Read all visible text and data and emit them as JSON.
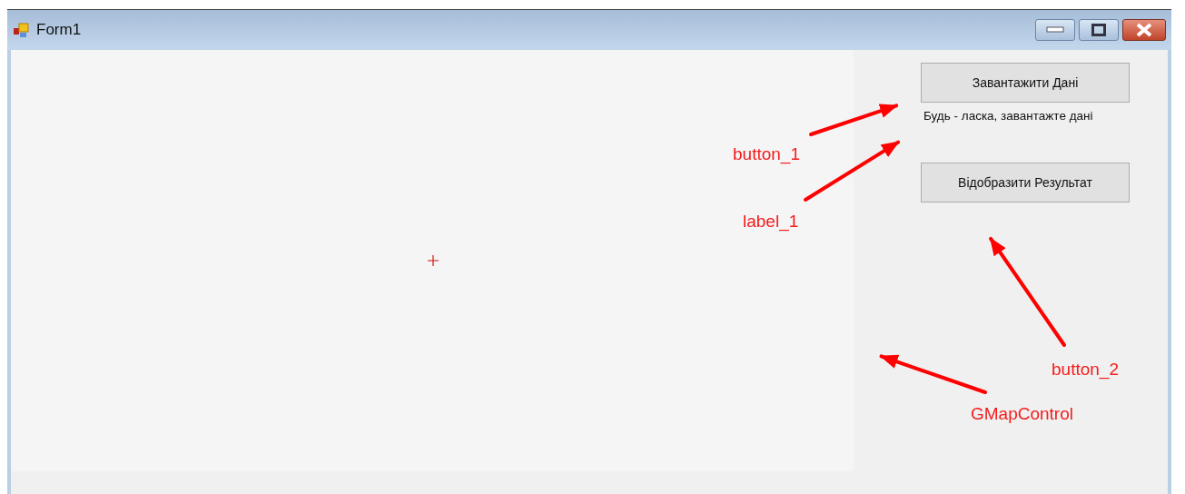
{
  "window": {
    "title": "Form1"
  },
  "buttons": [
    {
      "label": "Завантажити Дані"
    },
    {
      "label": "Відобразити Результат"
    }
  ],
  "label": {
    "text": "Будь - ласка, завантажте дані"
  },
  "annotations": [
    {
      "text": "button_1"
    },
    {
      "text": "label_1"
    },
    {
      "text": "button_2"
    },
    {
      "text": "GMapControl"
    }
  ]
}
